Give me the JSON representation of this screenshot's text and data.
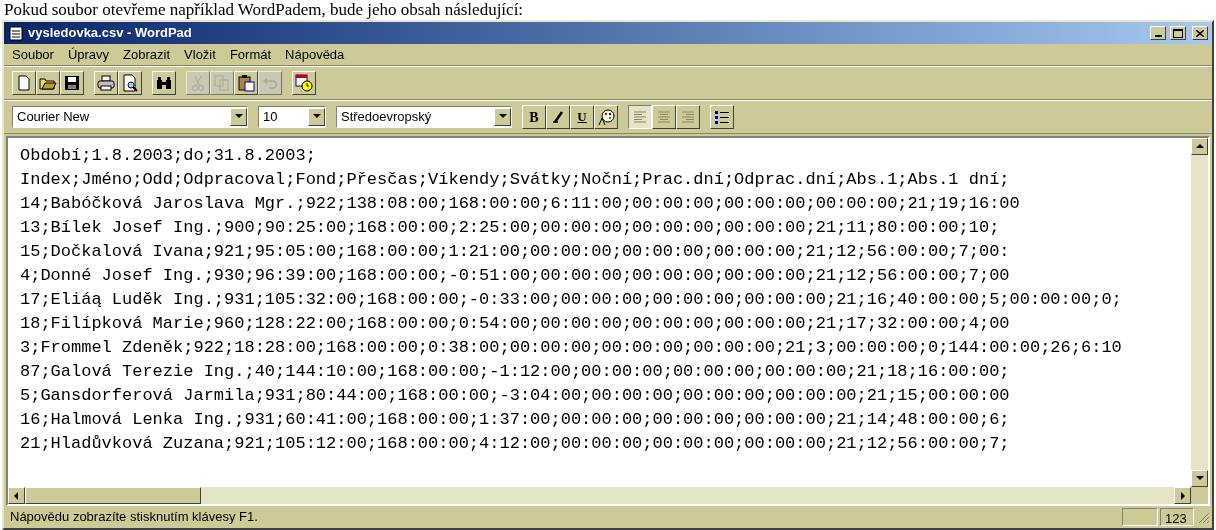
{
  "document_text": "Pokud soubor otevřeme například WordPadem, bude jeho obsah následující:",
  "window": {
    "title": "vysledovka.csv - WordPad"
  },
  "menu": [
    {
      "label": "Soubor"
    },
    {
      "label": "Úpravy"
    },
    {
      "label": "Zobrazit"
    },
    {
      "label": "Vložit"
    },
    {
      "label": "Formát"
    },
    {
      "label": "Nápověda"
    }
  ],
  "toolbar": [
    [
      {
        "kind": "new",
        "disabled": false
      },
      {
        "kind": "open",
        "disabled": false
      },
      {
        "kind": "save",
        "disabled": false
      }
    ],
    [
      {
        "kind": "print",
        "disabled": false
      },
      {
        "kind": "preview",
        "disabled": false
      }
    ],
    [
      {
        "kind": "find",
        "disabled": false
      }
    ],
    [
      {
        "kind": "cut",
        "disabled": true
      },
      {
        "kind": "copy",
        "disabled": true
      },
      {
        "kind": "paste",
        "disabled": false
      },
      {
        "kind": "undo",
        "disabled": true
      }
    ],
    [
      {
        "kind": "datetime",
        "disabled": false
      }
    ]
  ],
  "format_bar": {
    "font": "Courier New",
    "size": "10",
    "script": "Středoevropský",
    "style_buttons": [
      {
        "kind": "bold",
        "label": "B"
      },
      {
        "kind": "italic"
      },
      {
        "kind": "underline",
        "label": "U"
      },
      {
        "kind": "color"
      }
    ],
    "align_buttons": [
      {
        "kind": "left",
        "selected": true
      },
      {
        "kind": "center",
        "selected": false
      },
      {
        "kind": "right",
        "selected": false
      }
    ],
    "bullets": {
      "kind": "bullets"
    }
  },
  "text_lines": [
    "Období;1.8.2003;do;31.8.2003;",
    "Index;Jméno;Odd;Odpracoval;Fond;Přesčas;Víkendy;Svátky;Noční;Prac.dní;Odprac.dní;Abs.1;Abs.1 dní;",
    "14;Babóčková Jaroslava Mgr.;922;138:08:00;168:00:00;6:11:00;00:00:00;00:00:00;00:00:00;21;19;16:00",
    "13;Bílek Josef Ing.;900;90:25:00;168:00:00;2:25:00;00:00:00;00:00:00;00:00:00;21;11;80:00:00;10;",
    "15;Dočkalová Ivana;921;95:05:00;168:00:00;1:21:00;00:00:00;00:00:00;00:00:00;21;12;56:00:00;7;00:",
    "4;Donné Josef Ing.;930;96:39:00;168:00:00;-0:51:00;00:00:00;00:00:00;00:00:00;21;12;56:00:00;7;00",
    "17;Eliáą Luděk Ing.;931;105:32:00;168:00:00;-0:33:00;00:00:00;00:00:00;00:00:00;21;16;40:00:00;5;00:00:00;0;",
    "18;Filípková Marie;960;128:22:00;168:00:00;0:54:00;00:00:00;00:00:00;00:00:00;21;17;32:00:00;4;00",
    "3;Frommel Zdeněk;922;18:28:00;168:00:00;0:38:00;00:00:00;00:00:00;00:00:00;21;3;00:00:00;0;144:00:00;26;6:10",
    "87;Galová Terezie Ing.;40;144:10:00;168:00:00;-1:12:00;00:00:00;00:00:00;00:00:00;21;18;16:00:00;",
    "5;Gansdorferová Jarmila;931;80:44:00;168:00:00;-3:04:00;00:00:00;00:00:00;00:00:00;21;15;00:00:00",
    "16;Halmová Lenka Ing.;931;60:41:00;168:00:00;1:37:00;00:00:00;00:00:00;00:00:00;21;14;48:00:00;6;",
    "21;Hladůvková Zuzana;921;105:12:00;168:00:00;4:12:00;00:00:00;00:00:00;00:00:00;21;12;56:00:00;7;"
  ],
  "status_bar": {
    "text": "Nápovědu zobrazíte stisknutím klávesy F1.",
    "num_lock": "123"
  }
}
